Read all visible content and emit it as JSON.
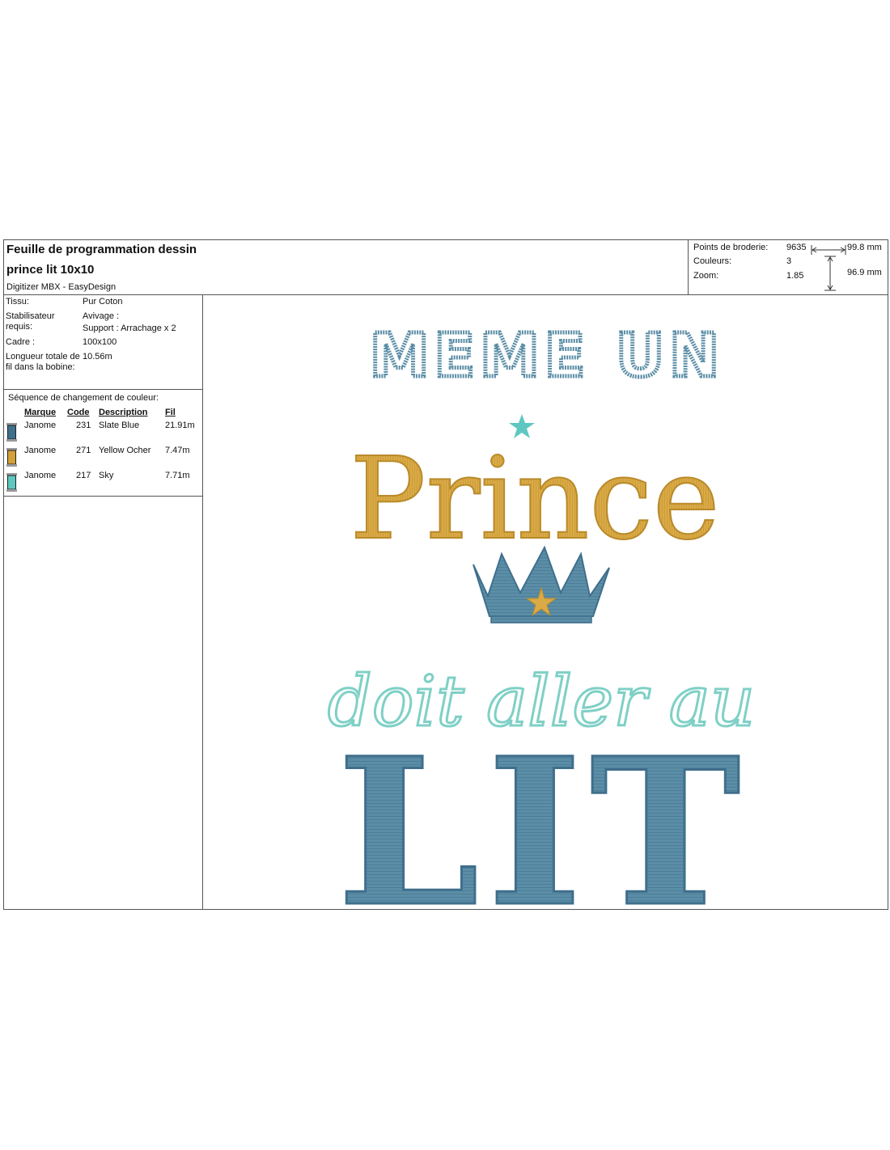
{
  "header": {
    "sheet_title": "Feuille de programmation dessin",
    "design_name": "prince lit 10x10",
    "software": "Digitizer MBX - EasyDesign"
  },
  "stats": {
    "stitches_label": "Points de broderie:",
    "stitches_value": "9635",
    "colors_label": "Couleurs:",
    "colors_value": "3",
    "zoom_label": "Zoom:",
    "zoom_value": "1.85",
    "width": "99.8 mm",
    "height": "96.9 mm"
  },
  "info": {
    "fabric_label": "Tissu:",
    "fabric_value": "Pur Coton",
    "stabilizer_label": "Stabilisateur requis:",
    "stabilizer_value_1": "Avivage :",
    "stabilizer_value_2": "Support : Arrachage x 2",
    "frame_label": "Cadre :",
    "frame_value": "100x100",
    "thread_label": "Longueur totale de fil dans la bobine:",
    "thread_value": "10.56m"
  },
  "sequence": {
    "title": "Séquence de changement de couleur:",
    "headers": {
      "brand": "Marque",
      "code": "Code",
      "description": "Description",
      "length": "Fil"
    },
    "rows": [
      {
        "brand": "Janome",
        "code": "231",
        "description": "Slate Blue",
        "length": "21.91m",
        "color": "#3f6f8c"
      },
      {
        "brand": "Janome",
        "code": "271",
        "description": "Yellow Ocher",
        "length": "7.47m",
        "color": "#d4a038"
      },
      {
        "brand": "Janome",
        "code": "217",
        "description": "Sky",
        "length": "7.71m",
        "color": "#5ec8c0"
      }
    ]
  },
  "design": {
    "line1": "MEME UN",
    "line2": "Prince",
    "line3": "doit aller au",
    "line4": "LIT",
    "colors": {
      "slate": "#5b8ea6",
      "slate_dark": "#3f6f8c",
      "ocher": "#d9aa45",
      "sky": "#7fd0c6"
    }
  }
}
